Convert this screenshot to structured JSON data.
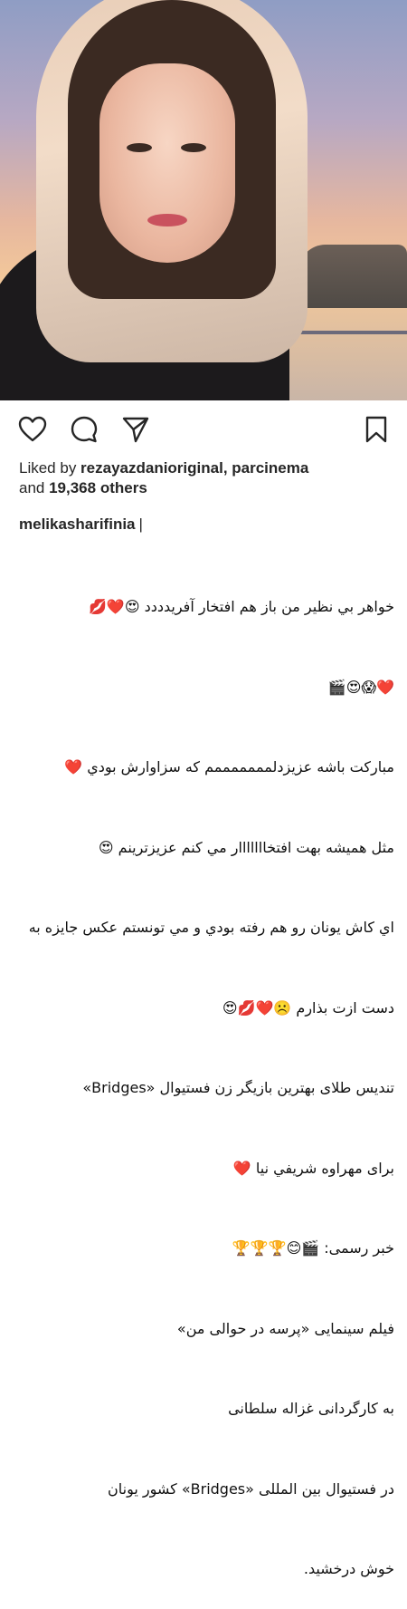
{
  "photo": {
    "alt_icon": "portrait-photo"
  },
  "actions": {
    "like_icon": "heart-icon",
    "comment_icon": "comment-icon",
    "share_icon": "share-icon",
    "save_icon": "bookmark-icon"
  },
  "likes": {
    "prefix": "Liked by ",
    "users": "rezayazdanioriginal, parcinema",
    "and": "and ",
    "count": "19,368 others"
  },
  "post": {
    "username": "melikasharifinia",
    "caption_lines": [
      "خواهر بي نظير من باز هم افتخار آفريدددد 😍❤️💋",
      "❤️😱😍🎬",
      "مبارکت باشه عزيزدلمممممممم که سزاوارش بودي ❤️",
      "مثل هميشه بهت افتخااااااار مي کنم عزيزترينم 😍",
      "اي کاش يونان رو هم رفته بودي و مي تونستم عکس جايزه به",
      "دست ازت بذارم ☹️❤️💋😍",
      "تنديس طلای بهترين بازيگر زن فستيوال «Bridges»",
      "برای مهراوه شريفي نيا ❤️",
      "خبر رسمی: 🎬😊🏆🏆🏆",
      "فيلم سينمايی «پرسه در حوالی من»",
      "به کارگردانی غزاله سلطانی",
      "در فستيوال بين المللی «Bridges» کشور يونان",
      "خوش درخشيد."
    ]
  }
}
